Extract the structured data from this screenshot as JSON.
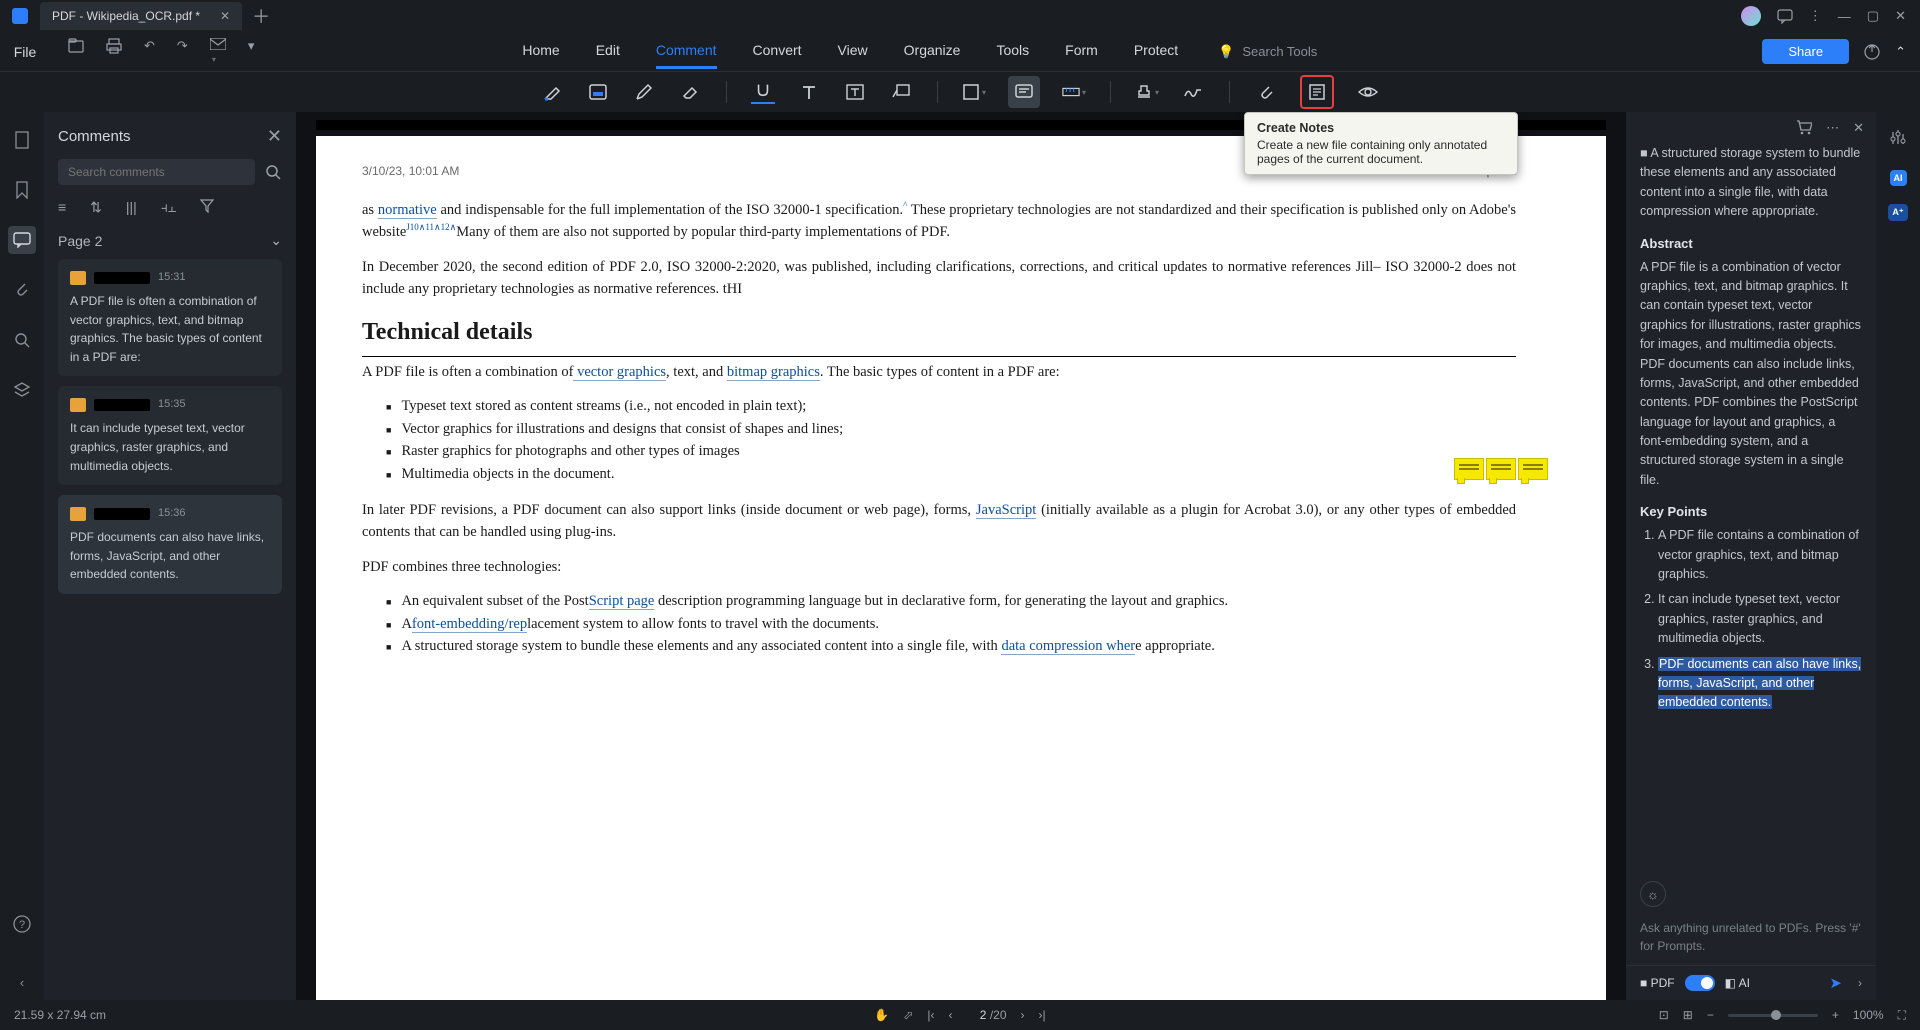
{
  "titlebar": {
    "tab": "PDF - Wikipedia_OCR.pdf *"
  },
  "menubar": {
    "file": "File",
    "tabs": [
      "Home",
      "Edit",
      "Comment",
      "Convert",
      "View",
      "Organize",
      "Tools",
      "Form",
      "Protect"
    ],
    "active": 2,
    "search": "Search Tools",
    "share": "Share"
  },
  "tooltip": {
    "title": "Create Notes",
    "body": "Create a new file containing only annotated pages of the current document."
  },
  "comments": {
    "title": "Comments",
    "search_ph": "Search comments",
    "page_label": "Page 2",
    "items": [
      {
        "time": "15:31",
        "text": "A PDF file is often a combination of vector graphics, text, and bitmap graphics. The basic types of content in a PDF are:"
      },
      {
        "time": "15:35",
        "text": "It can include typeset text, vector graphics, raster graphics, and multimedia objects."
      },
      {
        "time": "15:36",
        "text": "PDF documents can also have links, forms, JavaScript, and other embedded contents."
      }
    ]
  },
  "doc": {
    "header_left": "3/10/23, 10:01 AM",
    "header_right": "PDF - Wikipedia",
    "p1a": "as ",
    "p1_link1": "normative",
    "p1b": " and indispensable for the full implementation of the ISO 32000-1 specification.",
    "p1_sup": "^",
    "p1c": " These proprietary technologies are not standardized and their specification is published only on Adobe's website",
    "p1_suplinks": "J10∧11∧12∧",
    "p1d": "Many of them are also not supported by popular third-party implementations of PDF.",
    "p2": "In December 2020, the second edition of PDF 2.0, ISO 32000-2:2020, was published, including clarifications, corrections, and critical updates to normative references Jill– ISO 32000-2 does not include any proprietary technologies as normative references. tHI",
    "h2": "Technical details",
    "p3a": "A PDF file is often a combination of",
    "p3_link1": " vector graphics",
    "p3b": ", text, and ",
    "p3_link2": "bitmap graphics",
    "p3c": ". The basic types of content in a PDF are:",
    "li1": "Typeset text stored as content streams (i.e., not encoded in plain text);",
    "li2": "Vector graphics for illustrations and designs that consist of shapes and lines;",
    "li3": "Raster graphics for photographs and other types of images",
    "li4": "Multimedia objects in the document.",
    "p4a": "In later PDF revisions, a PDF document can also support links (inside document or web page), forms, ",
    "p4_link1": "JavaScript",
    "p4b": " (initially available as a plugin for Acrobat 3.0), or any other types of embedded contents that can be handled using plug-ins.",
    "p5": "PDF combines three technologies:",
    "li5a": "An equivalent subset of the Post",
    "li5_link": "Script page",
    "li5b": " description programming language but in declarative form, for generating the layout and graphics.",
    "li6a": "A",
    "li6_link": "font-embedding/rep",
    "li6b": "lacement system to allow fonts to travel with the documents.",
    "li7a": "A structured storage system to bundle these elements and any associated content into a single file, with ",
    "li7_link": "data compression wher",
    "li7b": "e appropriate."
  },
  "ai": {
    "pre_text": "A structured storage system to bundle these elements and any associated content into a single file, with data compression where appropriate.",
    "abstract_h": "Abstract",
    "abstract": "A PDF file is a combination of vector graphics, text, and bitmap graphics. It can contain typeset text, vector graphics for illustrations, raster graphics for images, and multimedia objects. PDF documents can also include links, forms, JavaScript, and other embedded contents. PDF combines the PostScript language for layout and graphics, a font-embedding system, and a structured storage system in a single file.",
    "keypoints_h": "Key Points",
    "kp1": "A PDF file contains a combination of vector graphics, text, and bitmap graphics.",
    "kp2": "It can include typeset text, vector graphics, raster graphics, and multimedia objects.",
    "kp3": "PDF documents can also have links, forms, JavaScript, and other embedded contents.",
    "ask_ph": "Ask anything unrelated to PDFs. Press '#' for Prompts.",
    "footer_pdf": "PDF",
    "footer_ai": "AI"
  },
  "status": {
    "left": "21.59 x 27.94 cm",
    "page_current": "2",
    "page_total": "/20",
    "zoom_label": "100%"
  }
}
